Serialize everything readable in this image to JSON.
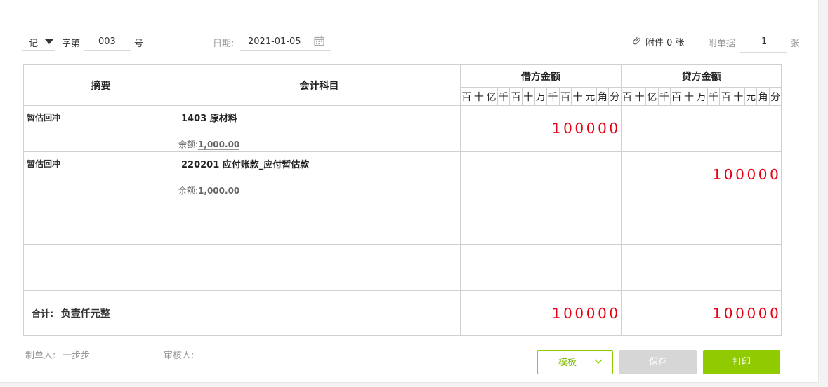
{
  "header": {
    "voucher_type": "记",
    "word_label": "字第",
    "number": "003",
    "number_suffix": "号",
    "date_label": "日期:",
    "date_value": "2021-01-05",
    "attachment_label": "附件 0 张",
    "attached_docs_label": "附单据",
    "attached_docs_count": "1",
    "attached_docs_unit": "张"
  },
  "table": {
    "col_summary": "摘要",
    "col_subject": "会计科目",
    "col_debit": "借方金额",
    "col_credit": "贷方金额",
    "digit_units": [
      "百",
      "十",
      "亿",
      "千",
      "百",
      "十",
      "万",
      "千",
      "百",
      "十",
      "元",
      "角",
      "分"
    ],
    "balance_label": "余额:",
    "rows": [
      {
        "summary": "暂估回冲",
        "subject": "1403 原材料",
        "balance": "1,000.00",
        "debit": "100000",
        "credit": ""
      },
      {
        "summary": "暂估回冲",
        "subject": "220201 应付账款_应付暂估款",
        "balance": "1,000.00",
        "debit": "",
        "credit": "100000"
      },
      {
        "summary": "",
        "subject": "",
        "balance": "",
        "debit": "",
        "credit": ""
      },
      {
        "summary": "",
        "subject": "",
        "balance": "",
        "debit": "",
        "credit": ""
      }
    ],
    "total_label": "合计:",
    "total_words": "负壹仟元整",
    "total_debit": "100000",
    "total_credit": "100000"
  },
  "footer": {
    "maker_label": "制单人:",
    "maker_name": "一步步",
    "reviewer_label": "审核人:",
    "template_button": "模板",
    "save_button": "保存",
    "print_button": "打印"
  },
  "colors": {
    "amount_red": "#e60012",
    "accent_green": "#8fcb00",
    "disabled_grey": "#d6d6d6",
    "yuan_line": "#e5b8b8",
    "group_line": "#a8d4ee"
  },
  "icons": {
    "dropdown": "caret-down-icon",
    "calendar": "calendar-icon",
    "attachment": "paperclip-icon",
    "template_menu": "chevron-down-icon"
  }
}
